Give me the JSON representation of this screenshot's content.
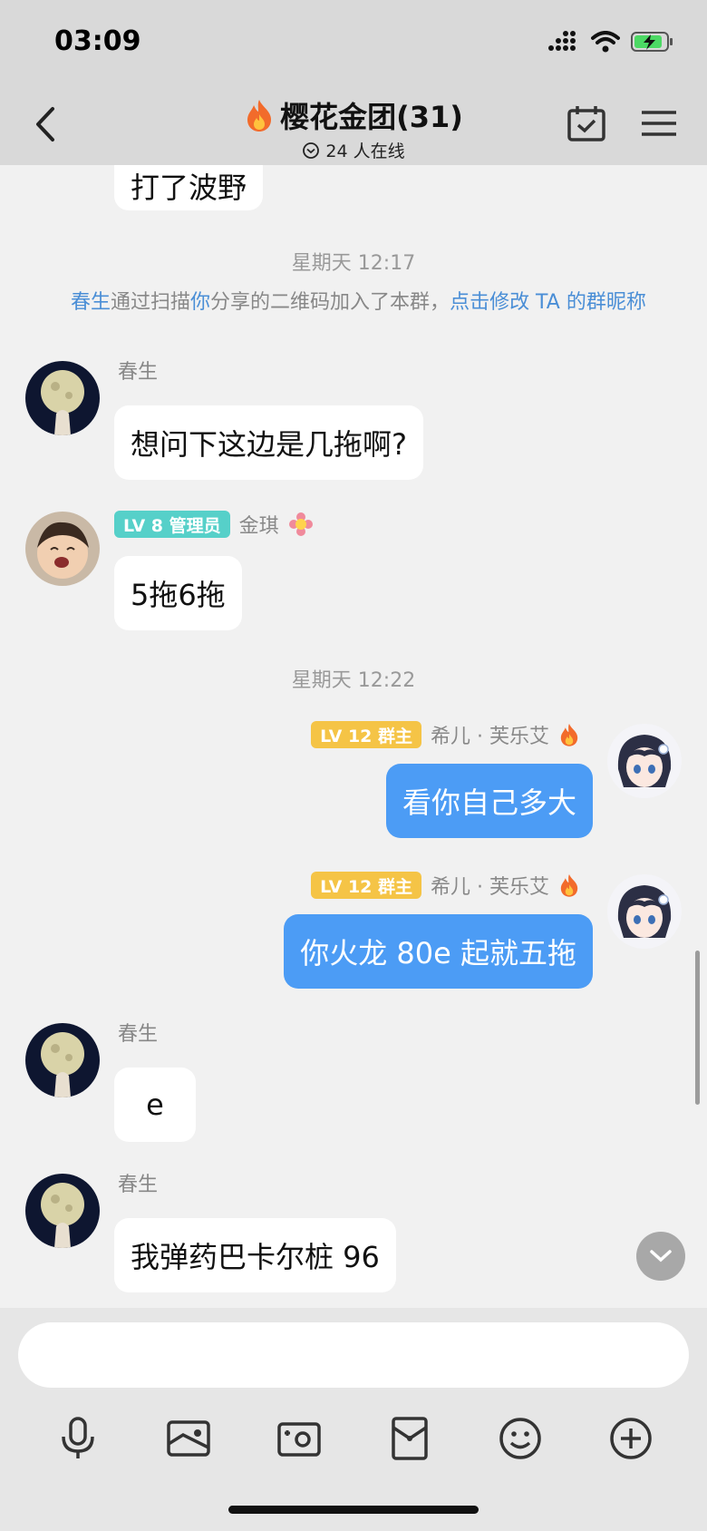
{
  "status_bar": {
    "time": "03:09"
  },
  "header": {
    "title": "樱花金团(31)",
    "online": "24 人在线"
  },
  "messages": {
    "partial_bubble": "打了波野",
    "time1": "星期天 12:17",
    "notice": {
      "name": "春生",
      "part1": "通过扫描",
      "you": "你",
      "part2": "分享的二维码加入了本群，",
      "action": "点击修改 TA 的群昵称"
    },
    "msg1": {
      "sender": "春生",
      "text": "想问下这边是几拖啊?"
    },
    "msg2": {
      "badge": "LV 8 管理员",
      "sender": "金琪",
      "text": "5拖6拖"
    },
    "time2": "星期天 12:22",
    "msg3": {
      "badge": "LV 12 群主",
      "sender": "希儿 · 芙乐艾",
      "text": "看你自己多大"
    },
    "msg4": {
      "badge": "LV 12 群主",
      "sender": "希儿 · 芙乐艾",
      "text": "你火龙 80e 起就五拖"
    },
    "msg5": {
      "sender": "春生",
      "text": "e"
    },
    "msg6": {
      "sender": "春生",
      "text": "我弹药巴卡尔桩 96"
    }
  },
  "input": {
    "placeholder": ""
  },
  "toolbar": {
    "icons": [
      "microphone-icon",
      "image-icon",
      "camera-icon",
      "red-packet-icon",
      "emoji-icon",
      "plus-icon"
    ]
  },
  "colors": {
    "outgoing_bubble": "#4c9cf5",
    "admin_badge": "#56d0c9",
    "owner_badge": "#f5c446",
    "link": "#4a8ed6"
  }
}
